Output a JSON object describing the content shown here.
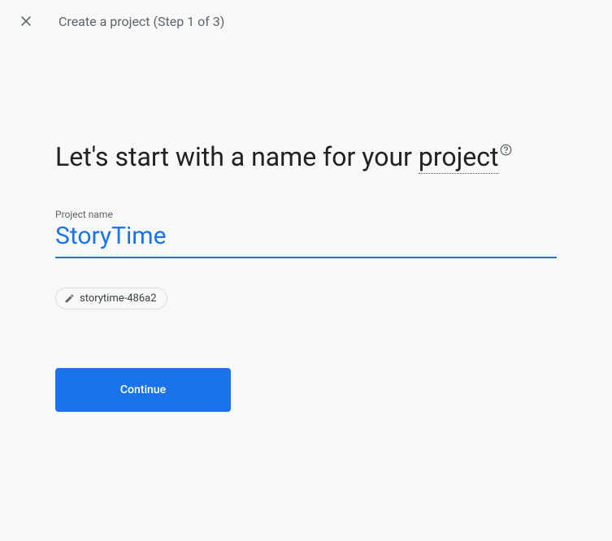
{
  "header": {
    "title": "Create a project (Step 1 of 3)"
  },
  "heading": {
    "prefix": "Let's start with a name for your ",
    "dotted_word": "project"
  },
  "field": {
    "label": "Project name",
    "value": "StoryTime"
  },
  "chip": {
    "project_id": "storytime-486a2"
  },
  "actions": {
    "continue_label": "Continue"
  }
}
